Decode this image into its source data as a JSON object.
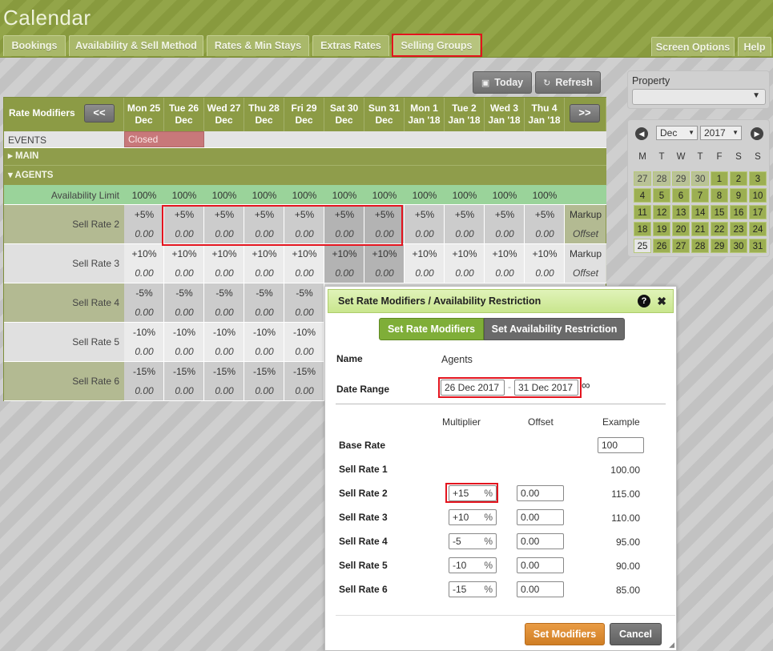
{
  "app": {
    "title": "Calendar"
  },
  "tabs": [
    "Bookings",
    "Availability & Sell Method",
    "Rates & Min Stays",
    "Extras Rates",
    "Selling Groups"
  ],
  "right_tabs": [
    "Screen Options",
    "Help"
  ],
  "toolbar": {
    "today": "Today",
    "refresh": "Refresh"
  },
  "grid": {
    "corner": "Rate Modifiers",
    "prev": "<<",
    "next": ">>",
    "days": [
      [
        "Mon 25",
        "Dec"
      ],
      [
        "Tue 26",
        "Dec"
      ],
      [
        "Wed 27",
        "Dec"
      ],
      [
        "Thu 28",
        "Dec"
      ],
      [
        "Fri 29",
        "Dec"
      ],
      [
        "Sat 30",
        "Dec"
      ],
      [
        "Sun 31",
        "Dec"
      ],
      [
        "Mon 1",
        "Jan '18"
      ],
      [
        "Tue 2",
        "Jan '18"
      ],
      [
        "Wed 3",
        "Jan '18"
      ],
      [
        "Thu 4",
        "Jan '18"
      ]
    ],
    "events_label": "EVENTS",
    "event_closed": "Closed",
    "main_label": "MAIN",
    "agents_label": "AGENTS",
    "avail_label": "Availability Limit",
    "avail": "100%",
    "rows": [
      {
        "label": "Sell Rate 2",
        "mult": "+5%",
        "offset": "0.00",
        "markup": "Markup",
        "offlabel": "Offset",
        "full": 11
      },
      {
        "label": "Sell Rate 3",
        "mult": "+10%",
        "offset": "0.00",
        "markup": "Markup",
        "offlabel": "Offset",
        "full": 11
      },
      {
        "label": "Sell Rate 4",
        "mult": "-5%",
        "offset": "0.00",
        "full": 5
      },
      {
        "label": "Sell Rate 5",
        "mult": "-10%",
        "offset": "0.00",
        "full": 5
      },
      {
        "label": "Sell Rate 6",
        "mult": "-15%",
        "offset": "0.00",
        "full": 5
      }
    ]
  },
  "property": {
    "label": "Property",
    "value": ""
  },
  "minical": {
    "month": "Dec",
    "year": "2017",
    "dow": [
      "M",
      "T",
      "W",
      "T",
      "F",
      "S",
      "S"
    ],
    "weeks": [
      [
        "27",
        "28",
        "29",
        "30",
        "1",
        "2",
        "3"
      ],
      [
        "4",
        "5",
        "6",
        "7",
        "8",
        "9",
        "10"
      ],
      [
        "11",
        "12",
        "13",
        "14",
        "15",
        "16",
        "17"
      ],
      [
        "18",
        "19",
        "20",
        "21",
        "22",
        "23",
        "24"
      ],
      [
        "25",
        "26",
        "27",
        "28",
        "29",
        "30",
        "31"
      ]
    ]
  },
  "dialog": {
    "title": "Set Rate Modifiers / Availability Restriction",
    "help": "?",
    "close": "✖",
    "seg_active": "Set Rate Modifiers",
    "seg_other": "Set Availability Restriction",
    "name_label": "Name",
    "name_value": "Agents",
    "range_label": "Date Range",
    "range_from": "26 Dec 2017",
    "range_sep": "-",
    "range_to": "31 Dec 2017",
    "infinity": "∞",
    "col_mult": "Multiplier",
    "col_offset": "Offset",
    "col_example": "Example",
    "base_label": "Base Rate",
    "base_value": "100",
    "sell1_label": "Sell Rate 1",
    "sell1_example": "100.00",
    "rates": [
      {
        "label": "Sell Rate 2",
        "mult": "+15",
        "offset": "0.00",
        "example": "115.00"
      },
      {
        "label": "Sell Rate 3",
        "mult": "+10",
        "offset": "0.00",
        "example": "110.00"
      },
      {
        "label": "Sell Rate 4",
        "mult": "-5",
        "offset": "0.00",
        "example": "95.00"
      },
      {
        "label": "Sell Rate 5",
        "mult": "-10",
        "offset": "0.00",
        "example": "90.00"
      },
      {
        "label": "Sell Rate 6",
        "mult": "-15",
        "offset": "0.00",
        "example": "85.00"
      }
    ],
    "pct": "%",
    "set_btn": "Set Modifiers",
    "cancel_btn": "Cancel"
  },
  "colors": {
    "green": "#8c9b45",
    "dialog_green": "#7fae38",
    "orange": "#dd8a2e"
  }
}
